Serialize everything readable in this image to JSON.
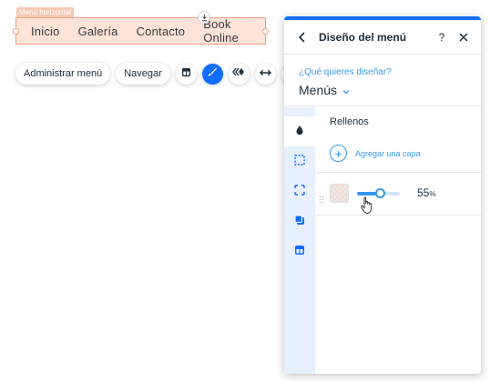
{
  "canvas": {
    "menu_tag": "Menú horizontal",
    "menu_items": [
      "Inicio",
      "Galería",
      "Contacto",
      "Book Online"
    ]
  },
  "toolbar": {
    "manage_menu_label": "Administrar menú",
    "navigate_label": "Navegar",
    "icons": [
      "layout-icon",
      "design-brush-icon",
      "animation-icon",
      "stretch-icon",
      "help-icon"
    ]
  },
  "panel": {
    "title": "Diseño del menú",
    "help": "?",
    "design_question": "¿Qué quieres diseñar?",
    "design_selected": "Menús",
    "side_icons": [
      "fill-drop-icon",
      "border-icon",
      "corners-icon",
      "shadow-icon",
      "layout-icon"
    ],
    "fills_title": "Rellenos",
    "add_layer_label": "Agregar una capa",
    "layer": {
      "opacity_value": "55",
      "opacity_unit": "%",
      "opacity_fraction": 0.55
    }
  },
  "colors": {
    "accent": "#116dff",
    "link": "#3899ec",
    "menu_highlight": "#fde3d8",
    "menu_border": "#f0a07f"
  }
}
